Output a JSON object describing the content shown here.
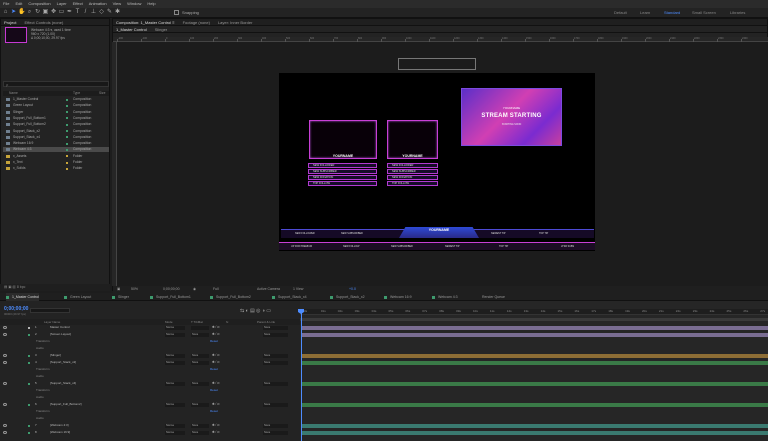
{
  "menu": [
    "File",
    "Edit",
    "Composition",
    "Layer",
    "Effect",
    "Animation",
    "View",
    "Window",
    "Help"
  ],
  "toolbar": {
    "snapping": "Snapping",
    "workspaces": [
      {
        "label": "Default",
        "active": false
      },
      {
        "label": "Learn",
        "active": false
      },
      {
        "label": "Standard",
        "active": true
      },
      {
        "label": "Small Screen",
        "active": false
      },
      {
        "label": "Libraries",
        "active": false
      }
    ]
  },
  "project": {
    "tabs": [
      "Project",
      "Effect Controls (none)"
    ],
    "selected_name": "Webcam 4:3 ▾, used 1 time",
    "info_lines": [
      "960 x 720 (1.00)",
      "Δ 0;00;10;00, 29.97 fps"
    ],
    "search_placeholder": "",
    "columns": {
      "name": "Name",
      "type": "Type",
      "size": "Size"
    },
    "items": [
      {
        "name": "1_Master Control",
        "type": "Composition",
        "label": "#3e9b6e",
        "folder": false,
        "selected": false
      },
      {
        "name": "Green Layout",
        "type": "Composition",
        "label": "#3e9b6e",
        "folder": false,
        "selected": false
      },
      {
        "name": "Slinger",
        "type": "Composition",
        "label": "#3e9b6e",
        "folder": false,
        "selected": false
      },
      {
        "name": "Support_Full_Bottom1",
        "type": "Composition",
        "label": "#3e9b6e",
        "folder": false,
        "selected": false
      },
      {
        "name": "Support_Full_Bottom2",
        "type": "Composition",
        "label": "#3e9b6e",
        "folder": false,
        "selected": false
      },
      {
        "name": "Support_Stack_x2",
        "type": "Composition",
        "label": "#3e9b6e",
        "folder": false,
        "selected": false
      },
      {
        "name": "Support_Stack_x4",
        "type": "Composition",
        "label": "#3e9b6e",
        "folder": false,
        "selected": false
      },
      {
        "name": "Webcam 16:9",
        "type": "Composition",
        "label": "#3e9b6e",
        "folder": false,
        "selected": false
      },
      {
        "name": "Webcam 4:3",
        "type": "Composition",
        "label": "#3e9b6e",
        "folder": false,
        "selected": true
      },
      {
        "name": "x_Assets",
        "type": "Folder",
        "label": "#c6a43a",
        "folder": true,
        "selected": false
      },
      {
        "name": "x_Text",
        "type": "Folder",
        "label": "#c6a43a",
        "folder": true,
        "selected": false
      },
      {
        "name": "x_Solids",
        "type": "Folder",
        "label": "#c6a43a",
        "folder": true,
        "selected": false
      }
    ],
    "bottom": "8 bpc"
  },
  "composition": {
    "tabs": [
      {
        "label": "Composition: 1_Master Control ≡",
        "on": true
      },
      {
        "label": "Footage (none)",
        "on": false
      },
      {
        "label": "Layer: Inner Border",
        "on": false
      }
    ],
    "subtabs": [
      "1_Master Control",
      "Slinger"
    ],
    "ruler_labels": [
      "-200",
      "-100",
      "0",
      "100",
      "200",
      "300",
      "400",
      "500",
      "600",
      "700",
      "800",
      "900",
      "1000",
      "1100",
      "1200",
      "1300",
      "1400",
      "1500",
      "1600",
      "1700",
      "1800",
      "1900",
      "2000",
      "2100",
      "2200",
      "2300",
      "2400"
    ],
    "overlay": {
      "cam_name": "YOURNAME",
      "banner_top": "YOURNAME",
      "banner_main": "STREAM STARTING",
      "banner_foot": "STARTING SOON",
      "buttons_left": [
        "NEW FOLLOWER",
        "NEW SUBSCRIBER",
        "NEW DONATION",
        "TOP FOLLOW"
      ],
      "buttons_right": [
        "NEW FOLLOWER",
        "NEW SUBSCRIBER",
        "NEW DONATION",
        "TOP FOLLOW"
      ],
      "bar1_labels": [
        "NEW FOLLOWER",
        "NEW SUBSCRIBER",
        "NEWEST TIP",
        "TOP TIP"
      ],
      "bar1_center": "YOURNAME",
      "bar2_labels": [
        "UP FOR PREMIUM",
        "NEW FOLLOW",
        "NEW SUBSCRIBER",
        "NEWEST TIP",
        "TOP TIP",
        "LTSR SUBS"
      ]
    },
    "bottom": {
      "zoom": "50%",
      "timecode": "0;00;00;00",
      "quality": "Full",
      "camera": "Active Camera",
      "view": "1 View",
      "offset": "+0.0"
    }
  },
  "timeline": {
    "tabs": [
      {
        "label": "1_Master Control",
        "color": "#3e9b6e",
        "on": true
      },
      {
        "label": "Green Layout",
        "color": "#3e9b6e",
        "on": false
      },
      {
        "label": "Slinger",
        "color": "#3e9b6e",
        "on": false
      },
      {
        "label": "Support_Full_Bottom1",
        "color": "#3e9b6e",
        "on": false
      },
      {
        "label": "Support_Full_Bottom2",
        "color": "#3e9b6e",
        "on": false
      },
      {
        "label": "Support_Stack_x4",
        "color": "#3e9b6e",
        "on": false
      },
      {
        "label": "Support_Stack_x2",
        "color": "#3e9b6e",
        "on": false
      },
      {
        "label": "Webcam 16:9",
        "color": "#3e9b6e",
        "on": false
      },
      {
        "label": "Webcam 4:3",
        "color": "#3e9b6e",
        "on": false
      },
      {
        "label": "Render Queue",
        "color": "",
        "on": false
      }
    ],
    "timecode": "0;00;00;00",
    "timecode_sub": "00000 (29.97 fps)",
    "columns": {
      "source": "Layer Name",
      "mode": "Mode",
      "trkmat": "T TrkMat",
      "switches": "fx",
      "parent": "Parent & Link"
    },
    "rows": [
      {
        "kind": "layer",
        "num": "1",
        "name": "Master Control",
        "mode": "Norma",
        "trk": "",
        "parent": "None",
        "color": "#b5b5b5",
        "bar": "#8a7aa6"
      },
      {
        "kind": "layer",
        "num": "2",
        "name": "[Screen Layout]",
        "mode": "Norma",
        "trk": "None",
        "parent": "None",
        "color": "#3e9b6e",
        "bar": "#8a7aa6"
      },
      {
        "kind": "sub",
        "name": "Transform",
        "reset": "Reset"
      },
      {
        "kind": "sub",
        "name": "Audio",
        "reset": ""
      },
      {
        "kind": "layer",
        "num": "3",
        "name": "[Slinger]",
        "mode": "Norma",
        "trk": "None",
        "parent": "None",
        "color": "#3e9b6e",
        "bar": "#a07a38"
      },
      {
        "kind": "layer",
        "num": "4",
        "name": "[Support_Stack_x2]",
        "mode": "Norma",
        "trk": "None",
        "parent": "None",
        "color": "#3e9b6e",
        "bar": "#3e8a4e"
      },
      {
        "kind": "sub",
        "name": "Transform",
        "reset": "Reset"
      },
      {
        "kind": "sub",
        "name": "Audio",
        "reset": ""
      },
      {
        "kind": "layer",
        "num": "5",
        "name": "[Support_Stack_x4]",
        "mode": "Norma",
        "trk": "None",
        "parent": "None",
        "color": "#3e9b6e",
        "bar": "#3e8a4e"
      },
      {
        "kind": "sub",
        "name": "Transform",
        "reset": "Reset"
      },
      {
        "kind": "sub",
        "name": "Audio",
        "reset": ""
      },
      {
        "kind": "layer",
        "num": "6",
        "name": "[Support_Full_Bottom2]",
        "mode": "Norma",
        "trk": "None",
        "parent": "None",
        "color": "#3e9b6e",
        "bar": "#3e8a4e"
      },
      {
        "kind": "sub",
        "name": "Transform",
        "reset": "Reset"
      },
      {
        "kind": "sub",
        "name": "Audio",
        "reset": ""
      },
      {
        "kind": "layer",
        "num": "7",
        "name": "[Webcam 4:3]",
        "mode": "Norma",
        "trk": "None",
        "parent": "None",
        "color": "#3e9b6e",
        "bar": "#3e8a7e"
      },
      {
        "kind": "layer",
        "num": "8",
        "name": "[Webcam 16:9]",
        "mode": "Norma",
        "trk": "None",
        "parent": "None",
        "color": "#3e9b6e",
        "bar": "#3e8a7e"
      }
    ],
    "ruler_labels": [
      "0s",
      "01s",
      "02s",
      "03s",
      "04s",
      "05s",
      "06s",
      "07s",
      "08s",
      "09s",
      "10s",
      "11s",
      "12s",
      "13s",
      "14s",
      "15s",
      "16s",
      "17s",
      "18s",
      "19s",
      "20s",
      "21s",
      "22s",
      "23s",
      "24s",
      "25s",
      "26s",
      "27s"
    ]
  }
}
